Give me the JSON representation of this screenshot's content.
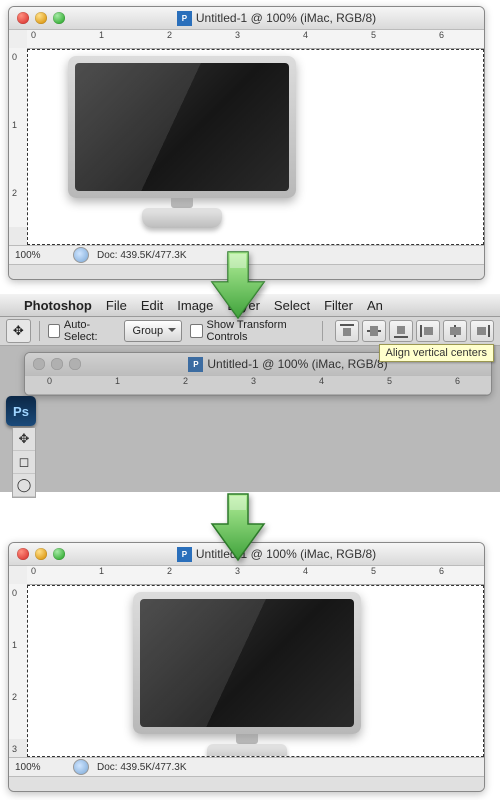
{
  "window": {
    "title": "Untitled-1 @ 100% (iMac, RGB/8)",
    "traffic": {
      "close": "close",
      "min": "minimize",
      "zoom": "zoom"
    }
  },
  "ruler": {
    "h": [
      "0",
      "1",
      "2",
      "3",
      "4",
      "5",
      "6"
    ],
    "v_top": [
      "0",
      "1",
      "2"
    ],
    "v_bottom": [
      "0",
      "1",
      "2",
      "3"
    ]
  },
  "status": {
    "zoom": "100%",
    "doc": "Doc: 439.5K/477.3K"
  },
  "menubar": {
    "app": "Photoshop",
    "items": [
      "File",
      "Edit",
      "Image",
      "Layer",
      "Select",
      "Filter",
      "An"
    ]
  },
  "optionsbar": {
    "auto_select_label": "Auto-Select:",
    "auto_select_checked": false,
    "group_dropdown": "Group",
    "show_transform_label": "Show Transform Controls",
    "show_transform_checked": false,
    "align_buttons": [
      "align-top-edges",
      "align-vertical-centers",
      "align-bottom-edges",
      "align-left-edges",
      "align-horizontal-centers",
      "align-right-edges"
    ],
    "tooltip": "Align vertical centers"
  },
  "ps_badge": "Ps",
  "toolstrip": [
    {
      "id": "move-tool",
      "glyph": "✥"
    },
    {
      "id": "marquee-tool",
      "glyph": "◻"
    },
    {
      "id": "lasso-tool",
      "glyph": "◯"
    },
    {
      "id": "wand-tool",
      "glyph": "✦"
    },
    {
      "id": "crop-tool",
      "glyph": "⊡"
    }
  ],
  "apple_glyph": ""
}
